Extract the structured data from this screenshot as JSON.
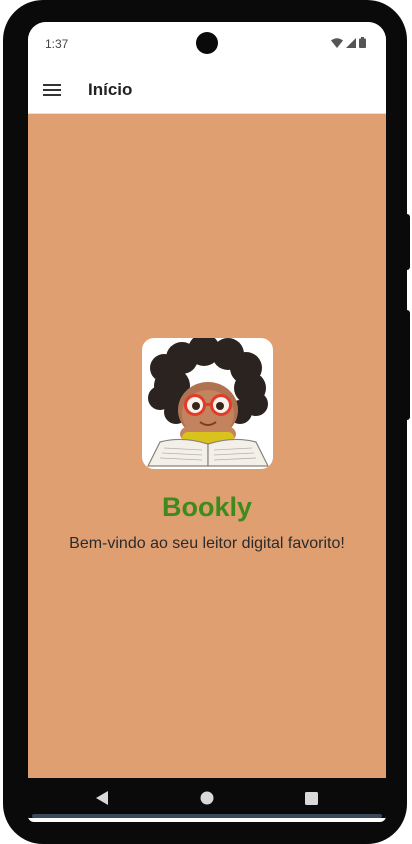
{
  "status_bar": {
    "time": "1:37",
    "icons": [
      "wifi-icon",
      "signal-icon",
      "battery-icon"
    ]
  },
  "app_bar": {
    "title": "Início",
    "menu_icon": "hamburger-menu-icon"
  },
  "main": {
    "background_color": "#e09f71",
    "logo": "girl-reading-book-illustration",
    "app_name": "Bookly",
    "app_name_color": "#3f8a1c",
    "welcome_text": "Bem-vindo ao seu leitor digital favorito!"
  },
  "nav_bar": {
    "buttons": [
      "back-icon",
      "home-icon",
      "recents-icon"
    ]
  }
}
